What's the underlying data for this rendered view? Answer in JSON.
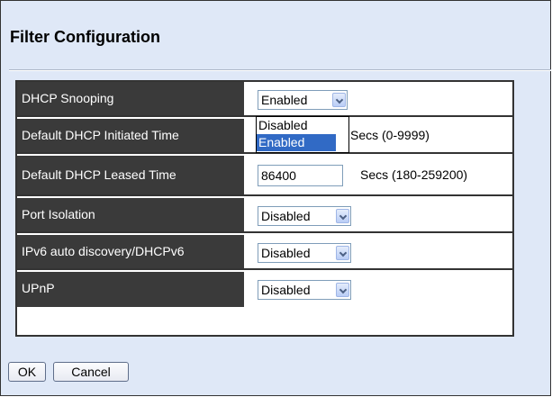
{
  "page": {
    "title": "Filter Configuration"
  },
  "rows": [
    {
      "label": "DHCP Snooping",
      "type": "select",
      "value": "Enabled"
    },
    {
      "label": "Default DHCP Initiated Time",
      "type": "text",
      "value": "",
      "unit": "Secs (0-9999)"
    },
    {
      "label": "Default DHCP Leased Time",
      "type": "text",
      "value": "86400",
      "unit": "Secs (180-259200)"
    },
    {
      "label": "Port Isolation",
      "type": "select",
      "value": "Disabled"
    },
    {
      "label": "IPv6 auto discovery/DHCPv6",
      "type": "select",
      "value": "Disabled"
    },
    {
      "label": "UPnP",
      "type": "select",
      "value": "Disabled"
    }
  ],
  "dropdown": {
    "options": [
      "Disabled",
      "Enabled"
    ],
    "highlighted": "Enabled"
  },
  "buttons": {
    "ok": "OK",
    "cancel": "Cancel"
  },
  "colors": {
    "background": "#dfe8f7",
    "label_bg": "#3a3a3a",
    "highlight": "#316ac5"
  }
}
